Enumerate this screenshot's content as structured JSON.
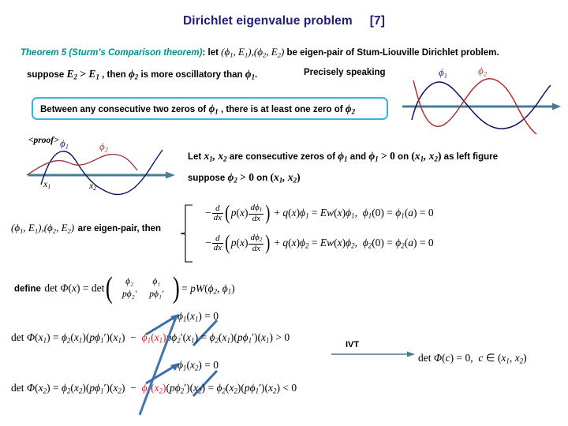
{
  "title": {
    "text": "Dirichlet eigenvalue problem",
    "reference": "[7]",
    "color": "#1f1f7a"
  },
  "theorem": {
    "name": "Theorem 5 (Sturm’s Comparison theorem)",
    "name_color": "#008f8f",
    "colon_let": ": let",
    "pairs": "(ϕ₁, E₁), (ϕ₂, E₂)",
    "tail": "be eigen-pair of Stum-Liouville Dirichlet problem."
  },
  "suppose_line": {
    "suppose": "suppose",
    "inequality": "E₂ > E₁",
    "then": ", then",
    "phi2": "ϕ₂",
    "more_oscillatory": "is more oscillatory than",
    "phi1": "ϕ₁",
    "period": ".",
    "precisely": "Precisely speaking"
  },
  "statement_box": {
    "border_color": "#2eb8e0",
    "text_a": "Between any consecutive two zeros of",
    "phi1": "ϕ₁",
    "text_b": ", there is at least one zero of",
    "phi2": "ϕ₂"
  },
  "proof_label": "<proof>",
  "let_line": {
    "let": "Let",
    "vars": "x₁, x₂",
    "are_consecutive": "are consecutive zeros of",
    "phi1": "ϕ₁",
    "and": "and",
    "phi1_pos": "ϕ₁ > 0",
    "on": "on",
    "interval": "(x₁, x₂)",
    "as_left_figure": "as left figure"
  },
  "suppose2": {
    "suppose": "suppose",
    "phi2_pos": "ϕ₂ > 0",
    "on": "on",
    "interval": "(x₁, x₂)"
  },
  "eigenpair_line": {
    "pairs": "(ϕ₁, E₁), (ϕ₂, E₂)",
    "text": "are eigen-pair, then"
  },
  "ode_system": {
    "eq1": {
      "minus": "−",
      "d": "d",
      "dx": "dx",
      "p_of_x": "p(x)",
      "dphi": "dϕ₁",
      "plus_q": "+ q(x)ϕ₁ =",
      "rhs": "Ew(x)ϕ₁,",
      "bc": "ϕ₁(0) = ϕ₁(a) = 0"
    },
    "eq2": {
      "minus": "−",
      "d": "d",
      "dx": "dx",
      "p_of_x": "p(x)",
      "dphi": "dϕ₂",
      "plus_q": "+ q(x)ϕ₂ =",
      "rhs": "Ew(x)ϕ₂,",
      "bc": "ϕ₂(0) = ϕ₂(a) = 0"
    }
  },
  "define_line": {
    "define": "define",
    "lhs": "det Φ(x) = det",
    "m11": "ϕ₂",
    "m12": "ϕ₁",
    "m21": "pϕ₂′",
    "m22": "pϕ₁′",
    "rhs": "= pW(ϕ₂, ϕ₁)"
  },
  "det_x1": {
    "annotation": "ϕ₁(x₁) = 0",
    "lhs": "det Φ(x₁) = ϕ₂(x₁)(pϕ₁′)(x₁)",
    "minus": "−",
    "struck": "ϕ₁(x₁)",
    "struck_color": "#d0202a",
    "rest": "pϕ₂′(x₁) = ϕ₂(x₁)(pϕ₁′)(x₁) > 0"
  },
  "det_x2": {
    "annotation": "ϕ₁(x₂) = 0",
    "lhs": "det Φ(x₂) = ϕ₂(x₂)(pϕ₁′)(x₂)",
    "minus": "−",
    "struck": "ϕ₁(x₂)",
    "struck_color": "#d0202a",
    "rest": "(pϕ₂′)(x₂) = ϕ₂(x₂)(pϕ₁′)(x₂) < 0"
  },
  "ivt": {
    "label": "IVT",
    "result": "det Φ(c) = 0,  c ∈ (x₁, x₂)"
  },
  "figures": {
    "top_right": {
      "label_phi1": "ϕ₁",
      "label_phi2": "ϕ₂",
      "phi1_color": "#101060",
      "phi2_color": "#b03030",
      "axis_color": "#4a7a96"
    },
    "left": {
      "label_phi1": "ϕ₁",
      "label_phi2": "ϕ₂",
      "label_x1": "x₁",
      "label_x2": "x₂",
      "phi1_color": "#101060",
      "phi2_color": "#9e3b40",
      "axis_color": "#4a7a96"
    }
  },
  "arrow_color": "#4a7a96",
  "blue_arrow_color": "#3a6ea8"
}
